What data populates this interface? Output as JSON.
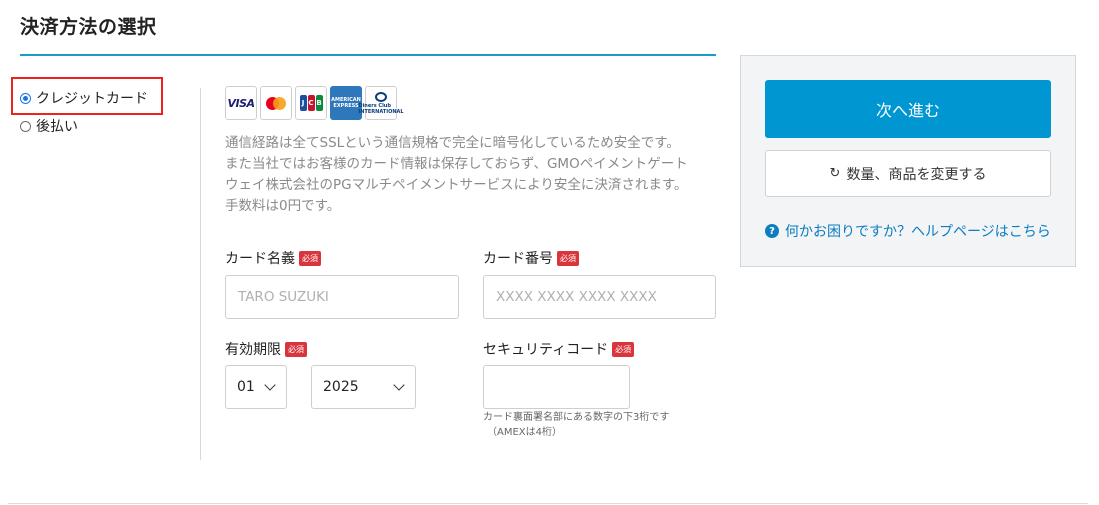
{
  "section_title": "決済方法の選択",
  "payment_methods": [
    {
      "label": "クレジットカード",
      "selected": true
    },
    {
      "label": "後払い",
      "selected": false
    }
  ],
  "card_brands": [
    "VISA",
    "Mastercard",
    "JCB",
    "American Express",
    "Diners Club"
  ],
  "card_brand_text": {
    "visa": "VISA",
    "jcb": [
      "J",
      "C",
      "B"
    ],
    "amex": "AMERICAN EXPRESS",
    "diners": "Diners Club INTERNATIONAL"
  },
  "notice_lines": [
    "通信経路は全てSSLという通信規格で完全に暗号化しているため安全です。",
    "また当社ではお客様のカード情報は保存しておらず、GMOペイメントゲート",
    "ウェイ株式会社のPGマルチペイメントサービスにより安全に決済されます。",
    "手数料は0円です。"
  ],
  "required_badge": "必須",
  "form": {
    "card_name": {
      "label": "カード名義",
      "placeholder": "TARO SUZUKI"
    },
    "card_number": {
      "label": "カード番号",
      "placeholder": "XXXX XXXX XXXX XXXX"
    },
    "expiry": {
      "label": "有効期限",
      "month": "01",
      "year": "2025"
    },
    "security_code": {
      "label": "セキュリティコード",
      "hint_line1": "カード裏面署名部にある数字の下3桁です",
      "hint_line2": "（AMEXは4桁）"
    }
  },
  "sidebar": {
    "next_label": "次へ進む",
    "change_label": "数量、商品を変更する",
    "help_label": "何かお困りですか？ヘルプページはこちら"
  },
  "colors": {
    "accent": "#0096d1",
    "highlight_border": "#e8251f",
    "required": "#d9353d",
    "link": "#0c7dbf"
  }
}
